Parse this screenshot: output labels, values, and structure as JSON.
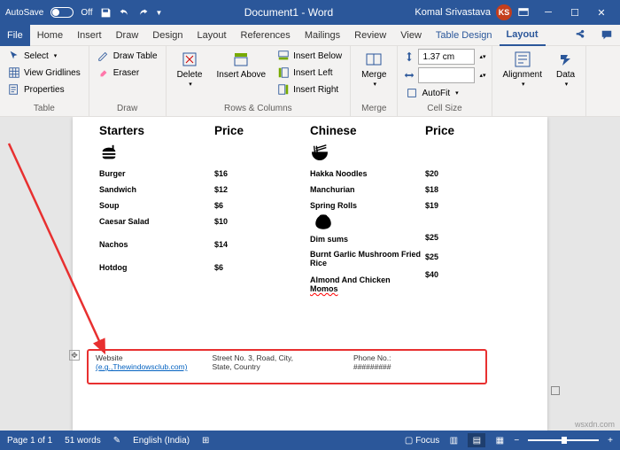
{
  "titlebar": {
    "autosave": "AutoSave",
    "off": "Off",
    "doc": "Document1 - Word",
    "user": "Komal Srivastava",
    "initials": "KS"
  },
  "tabs": {
    "file": "File",
    "home": "Home",
    "insert": "Insert",
    "draw": "Draw",
    "design": "Design",
    "layout": "Layout",
    "references": "References",
    "mailings": "Mailings",
    "review": "Review",
    "view": "View",
    "tabledesign": "Table Design",
    "layouttab": "Layout"
  },
  "ribbon": {
    "table": {
      "select": "Select",
      "gridlines": "View Gridlines",
      "properties": "Properties",
      "label": "Table"
    },
    "draw": {
      "drawtable": "Draw Table",
      "eraser": "Eraser",
      "label": "Draw"
    },
    "rowscols": {
      "delete": "Delete",
      "insertabove": "Insert Above",
      "insertbelow": "Insert Below",
      "insertleft": "Insert Left",
      "insertright": "Insert Right",
      "label": "Rows & Columns"
    },
    "merge": {
      "merge": "Merge",
      "label": "Merge"
    },
    "cellsize": {
      "height": "1.37 cm",
      "autofit": "AutoFit",
      "label": "Cell Size"
    },
    "align": {
      "alignment": "Alignment",
      "data": "Data"
    }
  },
  "menu": {
    "col1": {
      "h": "Starters",
      "items": [
        "Burger",
        "Sandwich",
        "Soup",
        "Caesar Salad",
        "",
        "Nachos",
        "",
        "Hotdog"
      ]
    },
    "col2": {
      "h": "Price",
      "items": [
        "$16",
        "$12",
        "$6",
        "$10",
        "",
        "$14",
        "",
        "$6"
      ]
    },
    "col3": {
      "h": "Chinese",
      "items": [
        "Hakka Noodles",
        "Manchurian",
        "Spring Rolls",
        "",
        "Dim sums",
        "Burnt Garlic Mushroom Fried Rice",
        "Almond And Chicken",
        "Momos"
      ]
    },
    "col4": {
      "h": "Price",
      "items": [
        "$20",
        "$18",
        "$19",
        "",
        "$25",
        "$25",
        "$40",
        ""
      ]
    }
  },
  "callout": {
    "website": "Website",
    "example": "(e.g.,Thewindowsclub.com)",
    "addr1": "Street No. 3, Road, City,",
    "addr2": "State, Country",
    "phone": "Phone No.:",
    "hashes": "#########"
  },
  "status": {
    "page": "Page 1 of 1",
    "words": "51 words",
    "lang": "English (India)",
    "focus": "Focus"
  },
  "watermark": "wsxdn.com"
}
